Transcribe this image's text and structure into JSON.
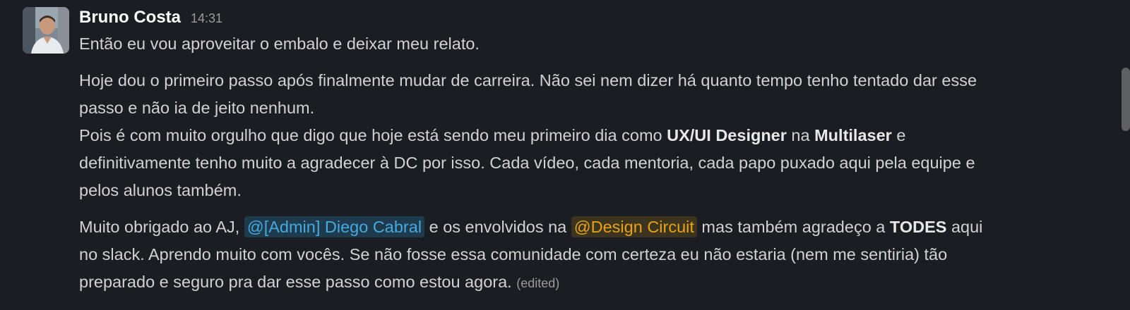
{
  "message": {
    "author": "Bruno Costa",
    "time": "14:31",
    "line1": "Então eu vou aproveitar o embalo e deixar meu relato.",
    "p2_l1": "Hoje dou o primeiro passo após finalmente mudar de carreira. Não sei nem dizer há quanto tempo tenho tentado dar esse",
    "p2_l2": "passo e não ia de jeito nenhum.",
    "p3_a": "Pois é com muito orgulho que digo que hoje está sendo meu primeiro dia como ",
    "p3_bold1": "UX/UI Designer",
    "p3_b": " na ",
    "p3_bold2": "Multilaser",
    "p3_c": " e",
    "p3_l2": "definitivamente tenho muito a agradecer à DC por isso. Cada vídeo, cada mentoria, cada papo puxado aqui pela equipe e",
    "p3_l3": "pelos alunos também.",
    "p4_a": "Muito obrigado ao AJ, ",
    "mention_user": "@[Admin] Diego Cabral",
    "p4_b": " e os envolvidos na ",
    "mention_group": "@Design Circuit",
    "p4_c": "  mas também agradeço a ",
    "p4_bold": "TODES",
    "p4_d": " aqui",
    "p4_l2": "no slack. Aprendo muito com vocês. Se não fosse essa comunidade com certeza eu não estaria (nem me sentiria) tão",
    "p4_l3": "preparado e seguro pra dar esse passo como estou agora. ",
    "edited": "(edited)"
  }
}
